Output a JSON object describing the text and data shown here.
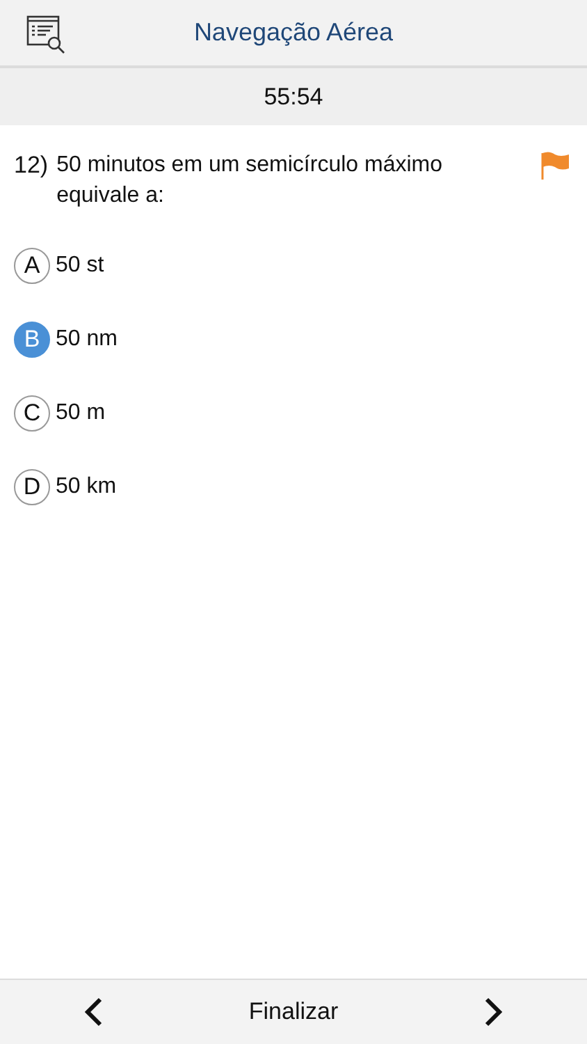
{
  "header": {
    "title": "Navegação Aérea"
  },
  "timer": "55:54",
  "question": {
    "number": "12)",
    "text": "50 minutos em um semicírculo máximo equivale a:",
    "flagged": true
  },
  "options": [
    {
      "letter": "A",
      "text": "50 st",
      "selected": false
    },
    {
      "letter": "B",
      "text": "50 nm",
      "selected": true
    },
    {
      "letter": "C",
      "text": "50 m",
      "selected": false
    },
    {
      "letter": "D",
      "text": "50 km",
      "selected": false
    }
  ],
  "footer": {
    "finish": "Finalizar"
  }
}
